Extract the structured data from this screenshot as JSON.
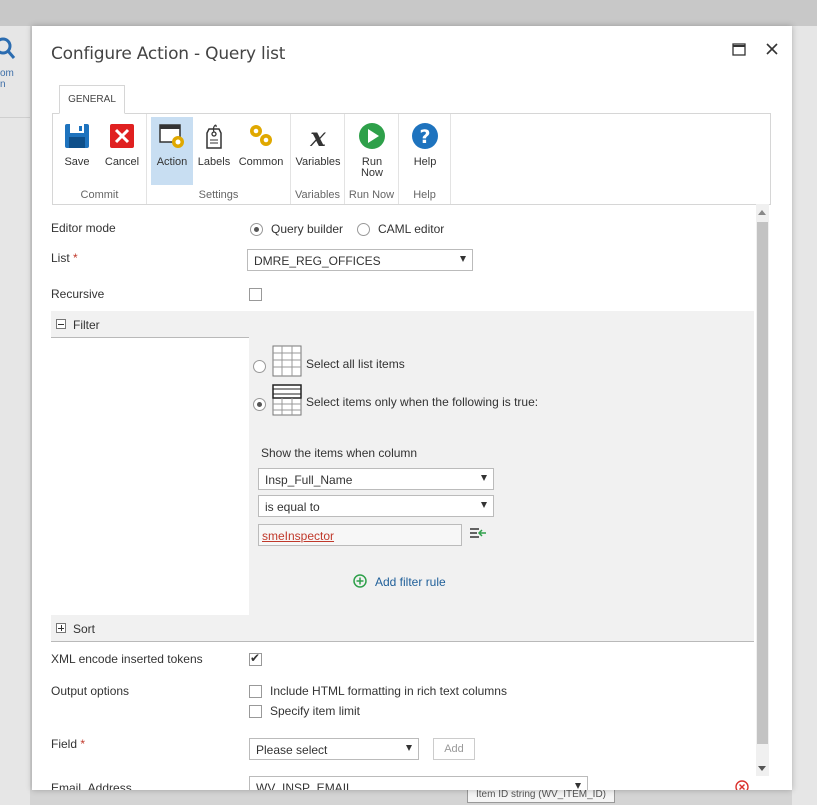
{
  "background": {
    "left_text_line1": "om",
    "left_text_line2": "n",
    "tooltip": "Item ID string (WV_ITEM_ID)"
  },
  "dialog": {
    "title": "Configure Action - Query list",
    "maximize_icon": "maximize-icon",
    "close_icon": "close-icon"
  },
  "ribbon": {
    "tab": "GENERAL",
    "groups": {
      "commit": "Commit",
      "settings": "Settings",
      "variables": "Variables",
      "run_now": "Run Now",
      "help": "Help"
    },
    "buttons": {
      "save": "Save",
      "cancel": "Cancel",
      "action": "Action",
      "labels": "Labels",
      "common": "Common",
      "variables": "Variables",
      "run_now_line1": "Run",
      "run_now_line2": "Now",
      "help": "Help"
    }
  },
  "form": {
    "editor_mode": {
      "label": "Editor mode",
      "options": [
        "Query builder",
        "CAML editor"
      ],
      "selected": "Query builder"
    },
    "list": {
      "label": "List",
      "required_mark": "*",
      "value": "DMRE_REG_OFFICES"
    },
    "recursive": {
      "label": "Recursive",
      "checked": false
    },
    "filter": {
      "title": "Filter",
      "select_all": "Select all list items",
      "select_when": "Select items only when the following is true:",
      "show_items_label": "Show the items when column",
      "column_value": "Insp_Full_Name",
      "operator_value": "is equal to",
      "value_text": "smeInspector",
      "add_rule": "Add filter rule"
    },
    "sort": {
      "title": "Sort"
    },
    "xml_encode": {
      "label": "XML encode inserted tokens",
      "checked": true
    },
    "output_options": {
      "label": "Output options",
      "include_html": "Include HTML formatting in rich text columns",
      "specify_limit": "Specify item limit"
    },
    "field": {
      "label": "Field",
      "required_mark": "*",
      "value": "Please select",
      "add_button": "Add"
    },
    "email_address": {
      "label": "Email_Address",
      "value": "WV_INSP_EMAIL"
    }
  },
  "colors": {
    "accent_blue": "#1e73be",
    "link_blue": "#1f5f99",
    "required_red": "#c0392b",
    "active_button_bg": "#c8def2",
    "add_green": "#2ea04a"
  }
}
